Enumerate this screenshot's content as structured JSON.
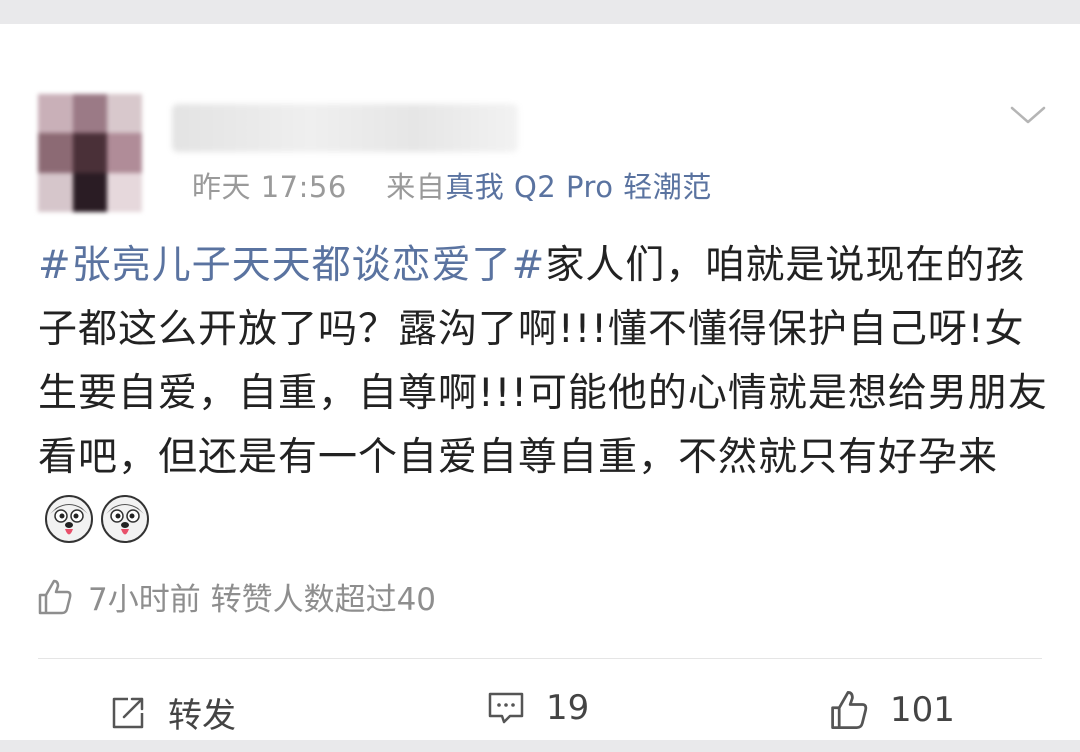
{
  "header": {
    "timestamp": "昨天 17:56",
    "source_prefix": "来自",
    "device": "真我 Q2 Pro 轻潮范"
  },
  "post": {
    "hashtag": "#张亮儿子天天都谈恋爱了#",
    "body": "家人们，咱就是说现在的孩子都这么开放了吗？露沟了啊!!!懂不懂得保护自己呀!女生要自爱，自重，自尊啊!!!可能他的心情就是想给男朋友看吧，但还是有一个自爱自尊自重，不然就只有好孕来",
    "emojis": [
      "husky-emoji",
      "husky-emoji"
    ]
  },
  "like_info": {
    "text": "7小时前 转赞人数超过40"
  },
  "actions": {
    "repost_label": "转发",
    "comment_count": "19",
    "like_count": "101"
  },
  "icons": {
    "chevron": "chevron-down-icon",
    "thumb": "thumb-up-icon",
    "repost": "repost-icon",
    "comment": "comment-icon"
  },
  "colors": {
    "link": "#5a73a0",
    "meta": "#9a9a9a",
    "text": "#222222"
  }
}
